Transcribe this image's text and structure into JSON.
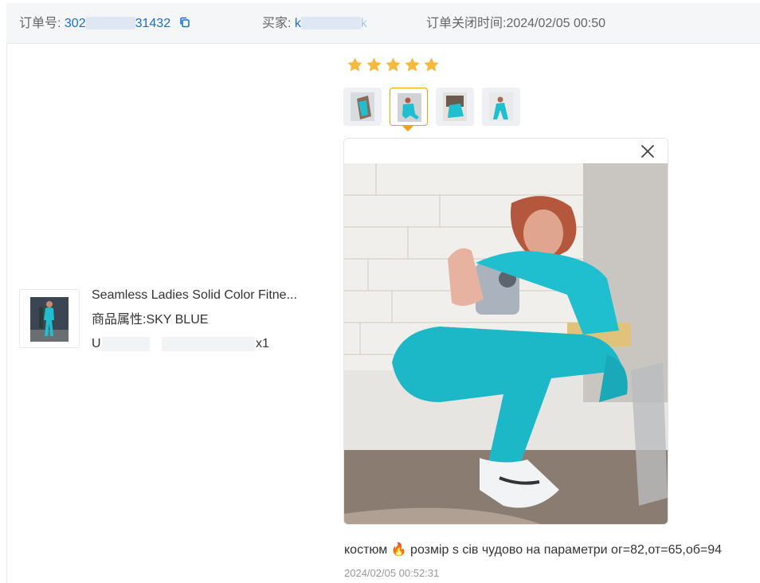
{
  "header": {
    "order_label": "订单号:",
    "order_id_start": "302",
    "order_id_end": "31432",
    "buyer_label": "买家:",
    "buyer_start": "k",
    "buyer_end": "k",
    "closed_label": "订单关闭时间:",
    "closed_time": "2024/02/05 00:50"
  },
  "product": {
    "title": "Seamless Ladies Solid Color Fitne...",
    "attr_label": "商品属性:",
    "attr_value": "SKY BLUE",
    "size_start": "U",
    "size_end": "x1"
  },
  "review": {
    "rating": 5,
    "thumbnail_count": 4,
    "selected_thumbnail": 2,
    "text": "костюм 🔥 розмір s сів чудово на параметри ог=82,от=65,об=94",
    "time": "2024/02/05 00:52:31"
  },
  "colors": {
    "link": "#1c6ed4",
    "star": "#f5b93b",
    "selected_border": "#f0a11c",
    "header_bg": "#f5f6f8",
    "outfit": "#1fbfcf"
  },
  "icons": [
    "copy-icon",
    "star-icon",
    "close-icon"
  ]
}
